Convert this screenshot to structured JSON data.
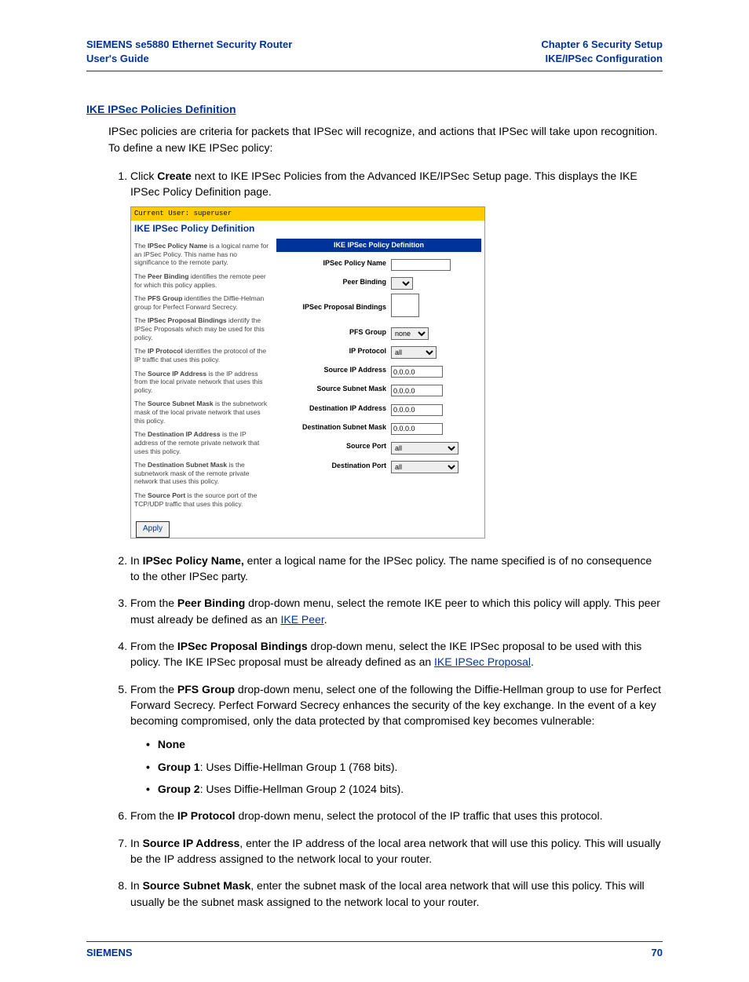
{
  "header": {
    "left_line1": "SIEMENS se5880 Ethernet Security Router",
    "left_line2": "User's Guide",
    "right_line1": "Chapter 6  Security Setup",
    "right_line2": "IKE/IPSec Configuration"
  },
  "section_title": "IKE IPSec Policies Definition",
  "intro": "IPSec policies are criteria for packets that IPSec will recognize, and actions that IPSec will take upon recognition. To define a new IKE IPSec policy:",
  "steps": {
    "s1_a": "Click ",
    "s1_b": "Create",
    "s1_c": " next to IKE IPSec Policies from the Advanced IKE/IPSec Setup page. This displays the IKE IPSec Policy Definition page.",
    "s2_a": "In ",
    "s2_b": "IPSec Policy Name,",
    "s2_c": " enter a logical name for the IPSec policy. The name specified is of no consequence to the other IPSec party.",
    "s3_a": "From the ",
    "s3_b": "Peer Binding",
    "s3_c": " drop-down menu, select the remote IKE peer to which this policy will apply. This peer must already be defined as an ",
    "s3_link": "IKE Peer",
    "s3_d": ".",
    "s4_a": "From the ",
    "s4_b": "IPSec Proposal Bindings",
    "s4_c": " drop-down menu, select the IKE IPSec proposal to be used with this policy. The IKE IPSec proposal must be already defined as an ",
    "s4_link": "IKE IPSec Proposal",
    "s4_d": ".",
    "s5_a": "From the ",
    "s5_b": "PFS Group",
    "s5_c": " drop-down menu, select one of the following the Diffie-Hellman group to use for Perfect Forward Secrecy. Perfect Forward Secrecy enhances the security of the key exchange. In the event of a key becoming compromised, only the data protected by that compromised key becomes vulnerable:",
    "s5_bul1": "None",
    "s5_bul2a": "Group 1",
    "s5_bul2b": ": Uses Diffie-Hellman Group 1 (768 bits).",
    "s5_bul3a": "Group 2",
    "s5_bul3b": ": Uses Diffie-Hellman Group 2 (1024 bits).",
    "s6_a": "From the ",
    "s6_b": "IP Protocol",
    "s6_c": " drop-down menu, select the protocol of the IP traffic that uses this protocol.",
    "s7_a": "In ",
    "s7_b": "Source IP Address",
    "s7_c": ", enter the IP address of the local area network that will use this policy. This will usually be the IP address assigned to the network local to your router.",
    "s8_a": "In ",
    "s8_b": "Source Subnet Mask",
    "s8_c": ", enter the subnet mask of the local area network that will use this policy. This will usually be the subnet mask assigned to the network local to your router."
  },
  "figure": {
    "user_line": "Current User: superuser",
    "title": "IKE IPSec Policy Definition",
    "panel_header": "IKE IPSec Policy Definition",
    "left_paras": [
      {
        "a": "The ",
        "b": "IPSec Policy Name",
        "c": " is a logical name for an IPSec Policy. This name has no significance to the remote party."
      },
      {
        "a": "The ",
        "b": "Peer Binding",
        "c": " identifies the remote peer for which this policy applies."
      },
      {
        "a": "The ",
        "b": "PFS Group",
        "c": " identifies the Diffie-Helman group for Perfect Forward Secrecy."
      },
      {
        "a": "The ",
        "b": "IPSec Proposal Bindings",
        "c": " identify the IPSec Proposals which may be used for this policy."
      },
      {
        "a": "The ",
        "b": "IP Protocol",
        "c": " identifies the protocol of the IP traffic that uses this policy."
      },
      {
        "a": "The ",
        "b": "Source IP Address",
        "c": " is the IP address from the local private network that uses this policy."
      },
      {
        "a": "The ",
        "b": "Source Subnet Mask",
        "c": " is the subnetwork mask of the local private network that uses this policy."
      },
      {
        "a": "The ",
        "b": "Destination IP Address",
        "c": " is the IP address of the remote private network that uses this policy."
      },
      {
        "a": "The ",
        "b": "Destination Subnet Mask",
        "c": " is the subnetwork mask of the remote private network that uses this policy."
      },
      {
        "a": "The ",
        "b": "Source Port",
        "c": " is the source port of the TCP/UDP traffic that uses this policy."
      }
    ],
    "rows": {
      "policy_name": {
        "label": "IPSec Policy Name",
        "value": ""
      },
      "peer_binding": {
        "label": "Peer Binding",
        "value": ""
      },
      "proposal": {
        "label": "IPSec Proposal Bindings",
        "value": ""
      },
      "pfs": {
        "label": "PFS Group",
        "value": "none"
      },
      "ip_proto": {
        "label": "IP Protocol",
        "value": "all"
      },
      "src_ip": {
        "label": "Source IP Address",
        "value": "0.0.0.0"
      },
      "src_mask": {
        "label": "Source Subnet Mask",
        "value": "0.0.0.0"
      },
      "dst_ip": {
        "label": "Destination IP Address",
        "value": "0.0.0.0"
      },
      "dst_mask": {
        "label": "Destination Subnet Mask",
        "value": "0.0.0.0"
      },
      "src_port": {
        "label": "Source Port",
        "value": "all"
      },
      "dst_port": {
        "label": "Destination Port",
        "value": "all"
      }
    },
    "apply": "Apply"
  },
  "footer": {
    "left": "SIEMENS",
    "right": "70"
  }
}
